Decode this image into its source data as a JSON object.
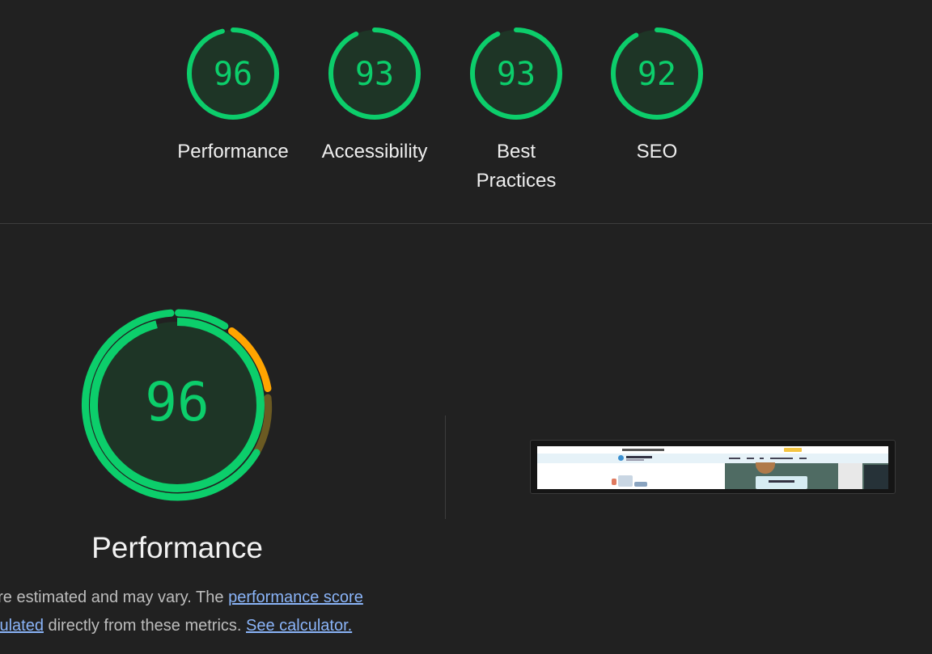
{
  "colors": {
    "pass": "#0cce6b",
    "average": "#ffa400",
    "gauge_fill": "#1e3526",
    "background": "#212121"
  },
  "categories": [
    {
      "id": "performance",
      "label": "Performance",
      "score": "96",
      "score_value": 96
    },
    {
      "id": "accessibility",
      "label": "Accessibility",
      "score": "93",
      "score_value": 93
    },
    {
      "id": "best-practices",
      "label": "Best Practices",
      "score": "93",
      "score_value": 93
    },
    {
      "id": "seo",
      "label": "SEO",
      "score": "92",
      "score_value": 92
    }
  ],
  "performance_section": {
    "score": "96",
    "title": "Performance",
    "description_prefix": "are estimated and may vary. The ",
    "link_score": "performance score",
    "description_middle_link": "lculated",
    "description_middle": " directly from these metrics. ",
    "link_calculator": "See calculator."
  }
}
